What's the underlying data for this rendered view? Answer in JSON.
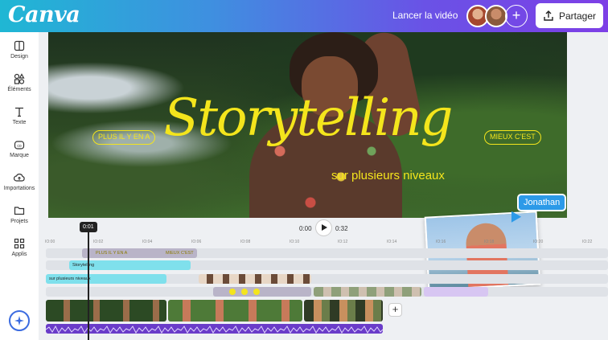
{
  "header": {
    "logo_text": "Canva",
    "launch_label": "Lancer la vidéo",
    "add_collaborator": "+",
    "share_label": "Partager"
  },
  "sidebar": {
    "items": [
      {
        "label": "Design",
        "icon": "layout-icon"
      },
      {
        "label": "Éléments",
        "icon": "shapes-icon"
      },
      {
        "label": "Texte",
        "icon": "text-icon"
      },
      {
        "label": "Marque",
        "icon": "brand-icon"
      },
      {
        "label": "Importations",
        "icon": "upload-icon"
      },
      {
        "label": "Projets",
        "icon": "folder-icon"
      },
      {
        "label": "Applis",
        "icon": "apps-icon"
      }
    ]
  },
  "canvas": {
    "title": "Storytelling",
    "subtitle": "sur plusieurs niveaux",
    "pill_left": "PLUS IL Y EN A",
    "pill_right": "MIEUX C'EST",
    "collaborator_name": "Jonathan"
  },
  "playback": {
    "current_badge": "0:01",
    "start_time": "0:00",
    "end_time": "0:32"
  },
  "timeline": {
    "ticks": [
      "IO:00",
      "IO:02",
      "IO:04",
      "IO:06",
      "IO:08",
      "IO:10",
      "IO:12",
      "IO:14",
      "IO:16",
      "IO:18",
      "IO:20",
      "IO:22"
    ],
    "track_storytelling": "Storytelling",
    "track_subtitle": "sur plusieurs niveaux",
    "mini_left": "PLUS IL Y EN A",
    "mini_right": "MIEUX C'EST",
    "add_label": "+"
  },
  "colors": {
    "accent_yellow": "#f4e51c",
    "brand_purple": "#7d3fe6",
    "brand_cyan": "#1fb7d4",
    "collab_blue": "#2c9ae8",
    "audio_purple": "#6a3cc9"
  }
}
